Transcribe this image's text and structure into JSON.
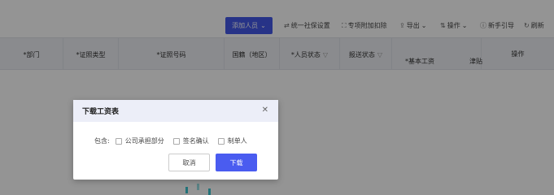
{
  "toolbar": {
    "add_label": "添加人员",
    "items": [
      {
        "label": "统一社保设置",
        "icon": "settings-sliders-icon"
      },
      {
        "label": "专项附加扣除",
        "icon": "expand-icon"
      },
      {
        "label": "导出",
        "icon": "export-icon"
      },
      {
        "label": "操作",
        "icon": "swap-icon"
      },
      {
        "label": "新手引导",
        "icon": "help-circle-icon"
      },
      {
        "label": "刷新",
        "icon": "refresh-icon"
      }
    ]
  },
  "table": {
    "headers": {
      "dept": "*部门",
      "id_type": "*证照类型",
      "id_number": "*证照号码",
      "country": "国籍（地区）",
      "person_status": "*人员状态",
      "report_status": "报送状态",
      "base_salary": "*基本工资",
      "allowance": "津贴",
      "actions": "操作"
    }
  },
  "dialog": {
    "title": "下载工资表",
    "include_label": "包含:",
    "options": [
      "公司承担部分",
      "签名确认",
      "制单人"
    ],
    "cancel": "取消",
    "confirm": "下载"
  },
  "colors": {
    "primary": "#4458e8",
    "header_bg": "#eef0f4",
    "dialog_head": "#eceef8"
  }
}
